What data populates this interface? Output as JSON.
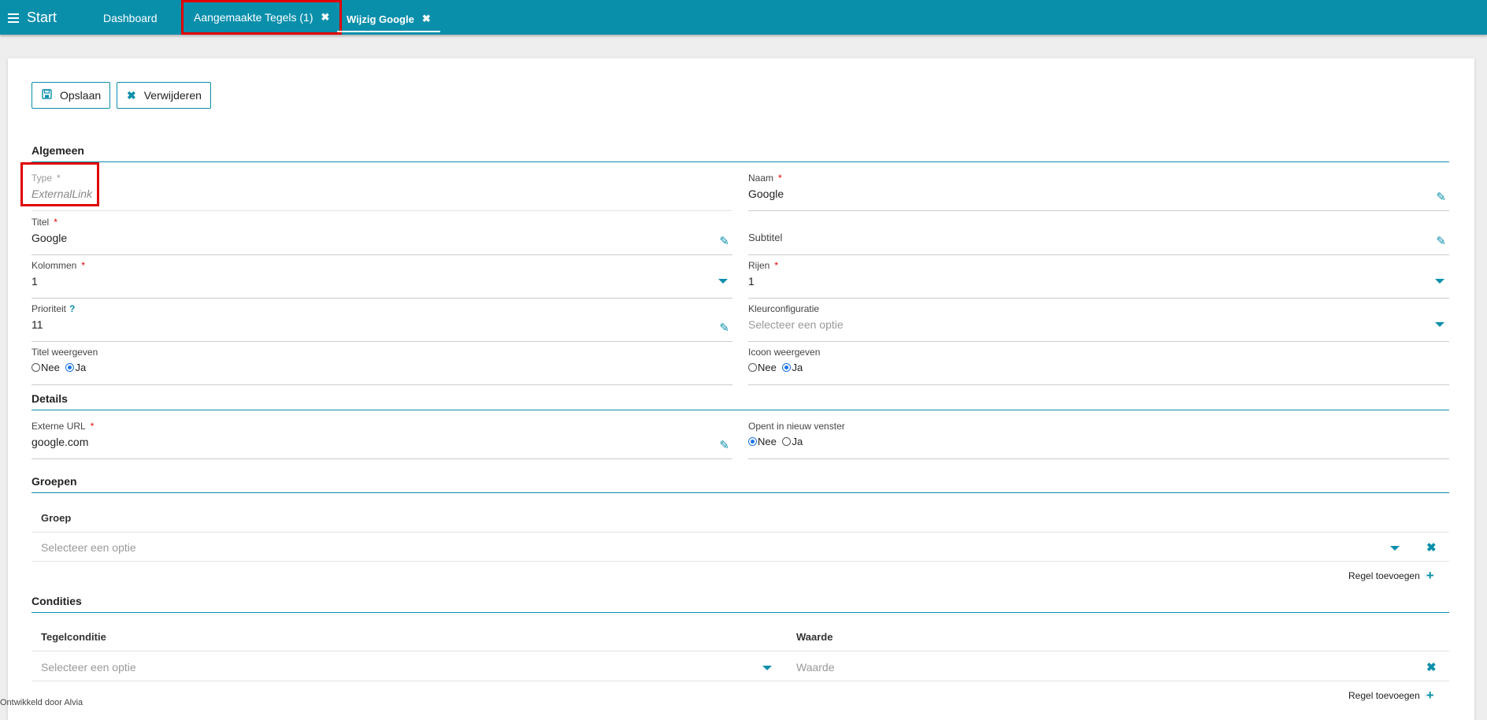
{
  "topbar": {
    "start_label": "Start",
    "tabs": [
      {
        "label": "Dashboard"
      },
      {
        "label": "Aangemaakte Tegels (1)",
        "close": "✖"
      },
      {
        "label": "Wijzig Google",
        "close": "✖"
      }
    ]
  },
  "toolbar": {
    "save_label": "Opslaan",
    "delete_label": "Verwijderen"
  },
  "sections": {
    "algemeen": "Algemeen",
    "details": "Details",
    "groepen": "Groepen",
    "condities": "Condities"
  },
  "fields": {
    "type": {
      "label": "Type",
      "value": "ExternalLink"
    },
    "naam": {
      "label": "Naam",
      "value": "Google"
    },
    "titel": {
      "label": "Titel",
      "value": "Google"
    },
    "subtitel": {
      "label": "Subtitel",
      "value": ""
    },
    "kolommen": {
      "label": "Kolommen",
      "value": "1"
    },
    "rijen": {
      "label": "Rijen",
      "value": "1"
    },
    "prioriteit": {
      "label": "Prioriteit",
      "value": "11",
      "help": "?"
    },
    "kleurconfiguratie": {
      "label": "Kleurconfiguratie",
      "placeholder": "Selecteer een optie"
    },
    "titel_weergeven": {
      "label": "Titel weergeven",
      "options": [
        "Nee",
        "Ja"
      ],
      "selected": "Ja"
    },
    "icoon_weergeven": {
      "label": "Icoon weergeven",
      "options": [
        "Nee",
        "Ja"
      ],
      "selected": "Ja"
    },
    "externe_url": {
      "label": "Externe URL",
      "value": "google.com"
    },
    "opent_nieuw_venster": {
      "label": "Opent in nieuw venster",
      "options": [
        "Nee",
        "Ja"
      ],
      "selected": "Nee"
    }
  },
  "required_mark": "*",
  "groepen_table": {
    "column": "Groep",
    "row_placeholder": "Selecteer een optie",
    "add_row_label": "Regel toevoegen"
  },
  "condities_table": {
    "columns": [
      "Tegelconditie",
      "Waarde"
    ],
    "row_placeholders": [
      "Selecteer een optie",
      "Waarde"
    ],
    "add_row_label": "Regel toevoegen"
  },
  "footer_text": "Ontwikkeld door Alvia",
  "colors": {
    "accent": "#0a8fab",
    "highlight": "#e00000",
    "required": "#e00000"
  },
  "icons": {
    "save": "floppy-disk-icon",
    "delete": "close-icon",
    "edit": "pencil-icon",
    "add": "plus-icon",
    "dropdown": "caret-down-icon"
  }
}
